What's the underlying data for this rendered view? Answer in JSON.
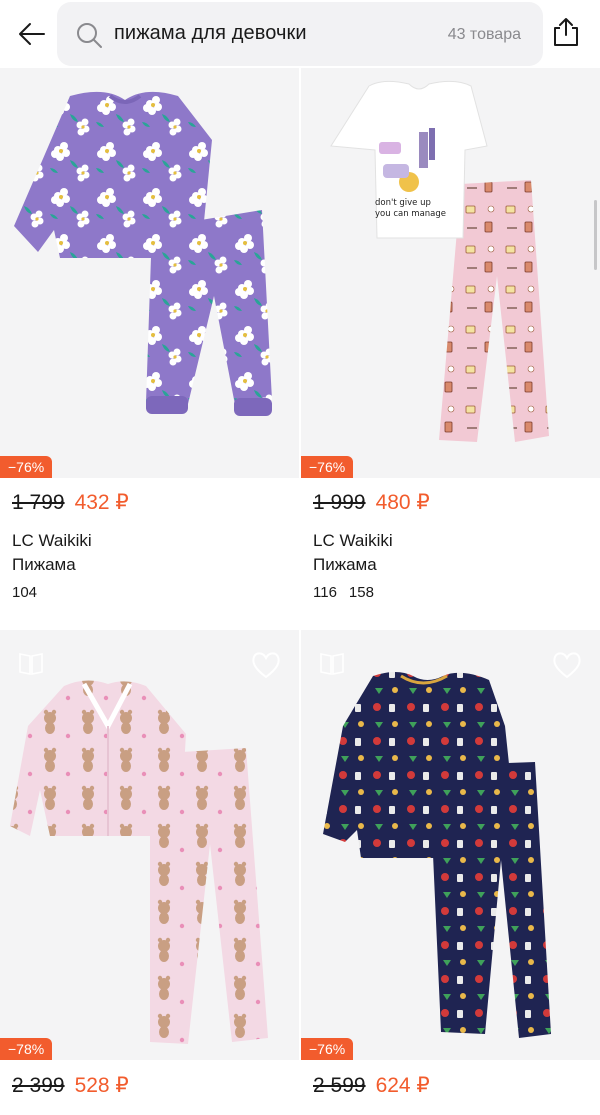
{
  "search": {
    "query": "пижама для девочки",
    "count": "43 товара"
  },
  "icons": {
    "back": "arrow-left-icon",
    "search": "search-icon",
    "share": "share-icon",
    "favorite": "heart-icon",
    "compare": "compare-icon"
  },
  "colors": {
    "accent": "#f25c2d",
    "search_bg": "#f2f2f4",
    "muted": "#8a8a8e"
  },
  "products": [
    {
      "badge": "−76%",
      "old_price": "1 799",
      "new_price": "432 ₽",
      "brand": "LC Waikiki",
      "name": "Пижама",
      "sizes": [
        "104"
      ],
      "print_text": ""
    },
    {
      "badge": "−76%",
      "old_price": "1 999",
      "new_price": "480 ₽",
      "brand": "LC Waikiki",
      "name": "Пижама",
      "sizes": [
        "116",
        "158"
      ],
      "print_text": "don't give up you can manage"
    },
    {
      "badge": "−78%",
      "old_price": "2 399",
      "new_price": "528 ₽"
    },
    {
      "badge": "−76%",
      "old_price": "2 599",
      "new_price": "624 ₽"
    }
  ]
}
